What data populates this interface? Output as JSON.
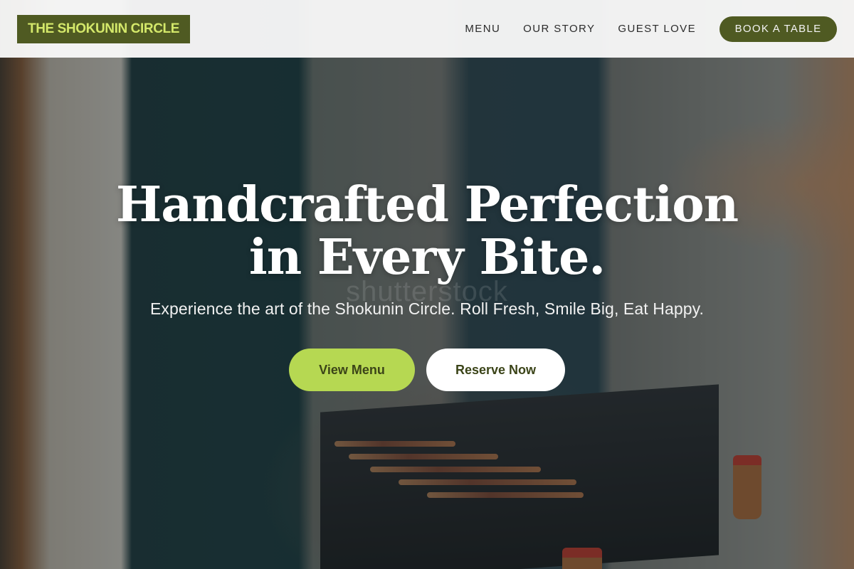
{
  "header": {
    "brand": "THE SHOKUNIN CIRCLE",
    "nav": [
      "MENU",
      "OUR STORY",
      "GUEST LOVE"
    ],
    "book_button": "BOOK A TABLE"
  },
  "hero": {
    "headline_line1": "Handcrafted Perfection",
    "headline_line2": "in Every Bite.",
    "subheadline": "Experience the art of the Shokunin Circle. Roll Fresh, Smile Big, Eat Happy.",
    "primary_cta": "View Menu",
    "secondary_cta": "Reserve Now",
    "watermark": "shutterstock"
  },
  "colors": {
    "brand_green": "#4f5a22",
    "brand_text_lime": "#d4e86a",
    "cta_lime": "#b6d852",
    "nav_background": "#f8f8f8"
  }
}
